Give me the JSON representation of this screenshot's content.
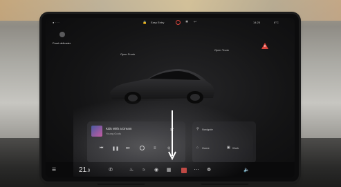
{
  "status_bar": {
    "left_text": "● · · ·",
    "profile_chip": "Easy Entry",
    "time": "14:25",
    "outside_temp": "8°C"
  },
  "profile": {
    "label": "Front defroster"
  },
  "car_view": {
    "front_trunk_label": "Open Frunk",
    "rear_trunk_label": "Open Trunk"
  },
  "media": {
    "track_title": "Kids With a Dream",
    "track_artist": "Young Gods"
  },
  "nav_card": {
    "search_placeholder": "Navigate",
    "home_label": "Home",
    "work_label": "Work"
  },
  "climate": {
    "driver_temp": "21",
    "unit": ".0"
  },
  "colors": {
    "screen_bg": "#0c0c0d",
    "alert_red": "#d9453c",
    "accent_blue": "#3c7fd9"
  }
}
